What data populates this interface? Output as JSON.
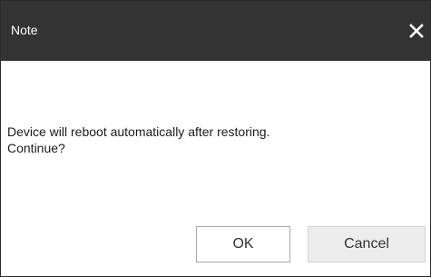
{
  "dialog": {
    "title": "Note",
    "close_icon": "close-icon",
    "message_line1": "Device will reboot automatically after restoring.",
    "message_line2": "Continue?",
    "ok_label": "OK",
    "cancel_label": "Cancel"
  },
  "colors": {
    "titlebar": "#333333",
    "title_text": "#ffffff",
    "cancel_button_bg": "#ededed",
    "ok_button_bg": "#ffffff"
  }
}
